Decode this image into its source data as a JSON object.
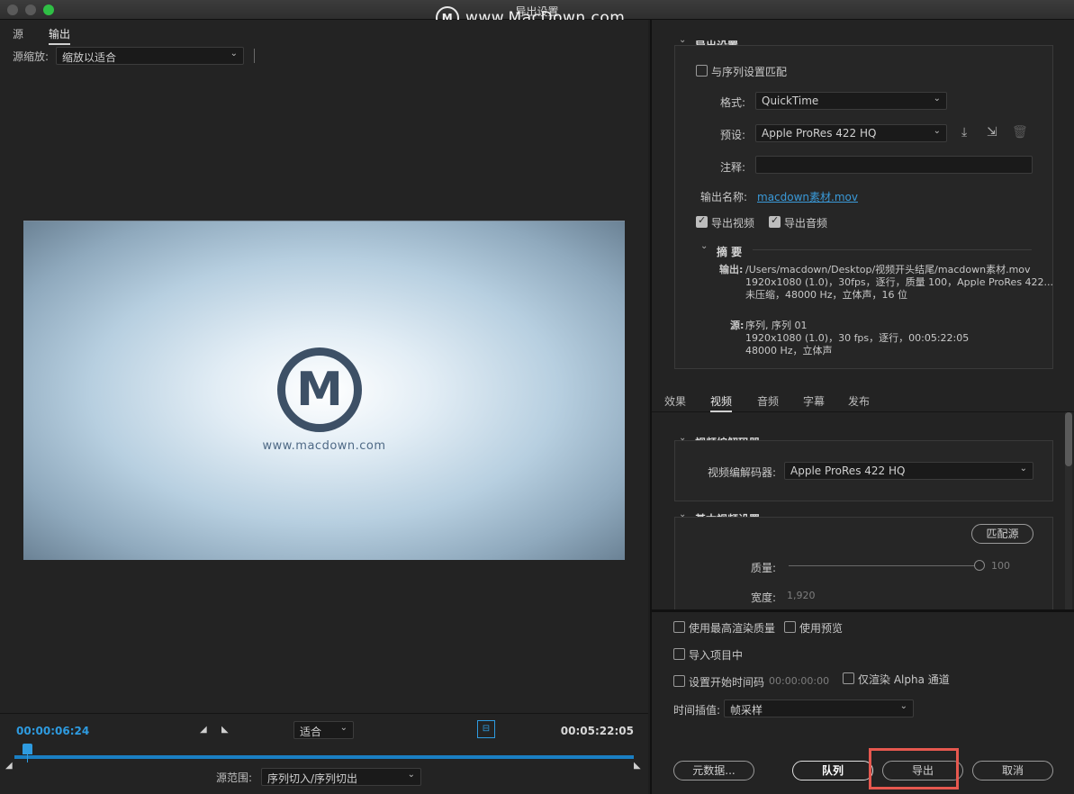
{
  "window": {
    "title": "导出设置",
    "watermark": "www.MacDown.com",
    "watermark_logo": "M"
  },
  "left_tabs": [
    "源",
    "输出"
  ],
  "source_zoom": {
    "label": "源缩放:",
    "value": "缩放以适合"
  },
  "preview": {
    "logo_letter": "M",
    "url": "www.macdown.com"
  },
  "timeline": {
    "current_tc": "00:00:06:24",
    "end_tc": "00:05:22:05",
    "fit_value": "适合",
    "playhead_fraction": 0.02,
    "range_label": "源范围:",
    "range_value": "序列切入/序列切出"
  },
  "export_settings": {
    "title": "导出设置",
    "match_sequence": "与序列设置匹配",
    "format_label": "格式:",
    "format_value": "QuickTime",
    "preset_label": "预设:",
    "preset_value": "Apple ProRes 422 HQ",
    "comments_label": "注释:",
    "output_name_label": "输出名称:",
    "output_name_value": "macdown素材.mov",
    "export_video": "导出视频",
    "export_audio": "导出音频",
    "summary_title": "摘 要",
    "output_label": "输出:",
    "output_lines": [
      "/Users/macdown/Desktop/视频开头结尾/macdown素材.mov",
      "1920x1080 (1.0)，30fps，逐行，质量 100，Apple ProRes 422...",
      "未压缩，48000 Hz，立体声，16 位"
    ],
    "source_label": "源:",
    "source_lines": [
      "序列, 序列 01",
      "1920x1080 (1.0)，30 fps，逐行，00:05:22:05",
      "48000 Hz，立体声"
    ]
  },
  "sub_tabs": [
    "效果",
    "视频",
    "音频",
    "字幕",
    "发布"
  ],
  "video_codec": {
    "title": "视频编解码器",
    "label": "视频编解码器:",
    "value": "Apple ProRes 422 HQ"
  },
  "basic_video": {
    "title": "基本视频设置",
    "match_source": "匹配源",
    "quality_label": "质量:",
    "quality_value": "100",
    "quality_fraction": 1.0,
    "width_label": "宽度:",
    "width_value": "1,920"
  },
  "bottom_options": {
    "max_render": "使用最高渲染质量",
    "use_previews": "使用预览",
    "import_project": "导入项目中",
    "set_start_tc": "设置开始时间码",
    "start_tc_value": "00:00:00:00",
    "alpha_only": "仅渲染 Alpha 通道",
    "interp_label": "时间插值:",
    "interp_value": "帧采样"
  },
  "buttons": {
    "metadata": "元数据...",
    "queue": "队列",
    "export": "导出",
    "cancel": "取消"
  }
}
